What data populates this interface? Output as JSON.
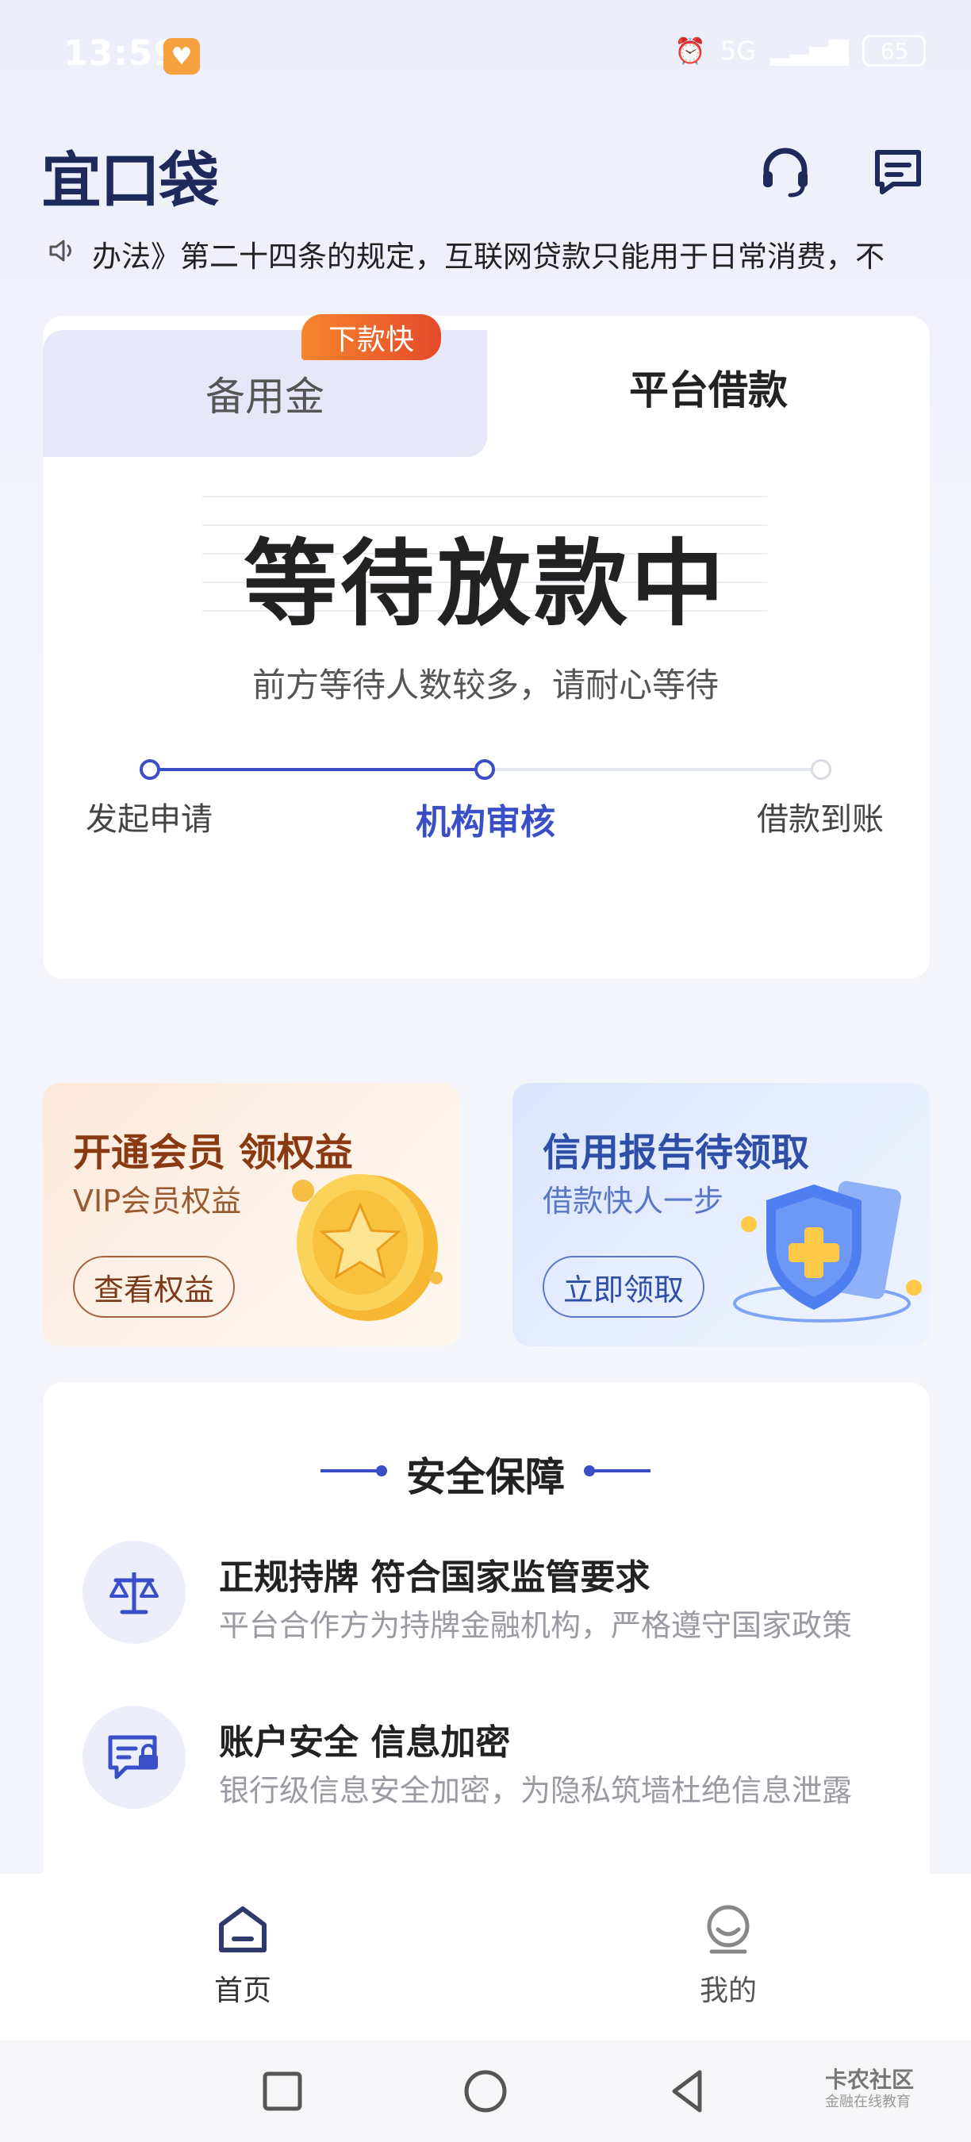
{
  "status_bar": {
    "time": "13:59",
    "battery": "65",
    "network": "5G"
  },
  "header": {
    "logo_text": "宜口袋",
    "support_icon": "headset-icon",
    "message_icon": "message-icon"
  },
  "notice": {
    "text": "办法》第二十四条的规定，互联网贷款只能用于日常消费，不"
  },
  "tabs": [
    {
      "label": "备用金",
      "badge": "下款快",
      "active": false
    },
    {
      "label": "平台借款",
      "active": true
    }
  ],
  "loan_status": {
    "title": "等待放款中",
    "subtitle": "前方等待人数较多，请耐心等待",
    "steps": [
      "发起申请",
      "机构审核",
      "借款到账"
    ],
    "current_step_index": 1
  },
  "promos": {
    "left": {
      "title": "开通会员 领权益",
      "subtitle": "VIP会员权益",
      "button": "查看权益",
      "icon": "coin-star-icon"
    },
    "right": {
      "title": "信用报告待领取",
      "subtitle": "借款快人一步",
      "button": "立即领取",
      "icon": "shield-icon"
    }
  },
  "safety": {
    "title": "安全保障",
    "items": [
      {
        "icon": "scale-icon",
        "heading": "正规持牌 符合国家监管要求",
        "desc": "平台合作方为持牌金融机构，严格遵守国家政策"
      },
      {
        "icon": "id-card-lock-icon",
        "heading": "账户安全 信息加密",
        "desc": "银行级信息安全加密，为隐私筑墙杜绝信息泄露"
      }
    ]
  },
  "bottom_nav": {
    "home": "首页",
    "mine": "我的"
  },
  "watermark": {
    "line1": "卡农社区",
    "line2": "金融在线教育"
  },
  "colors": {
    "accent": "#3a4fc7",
    "logo": "#1e2a5c",
    "badge": "#e4492b"
  }
}
